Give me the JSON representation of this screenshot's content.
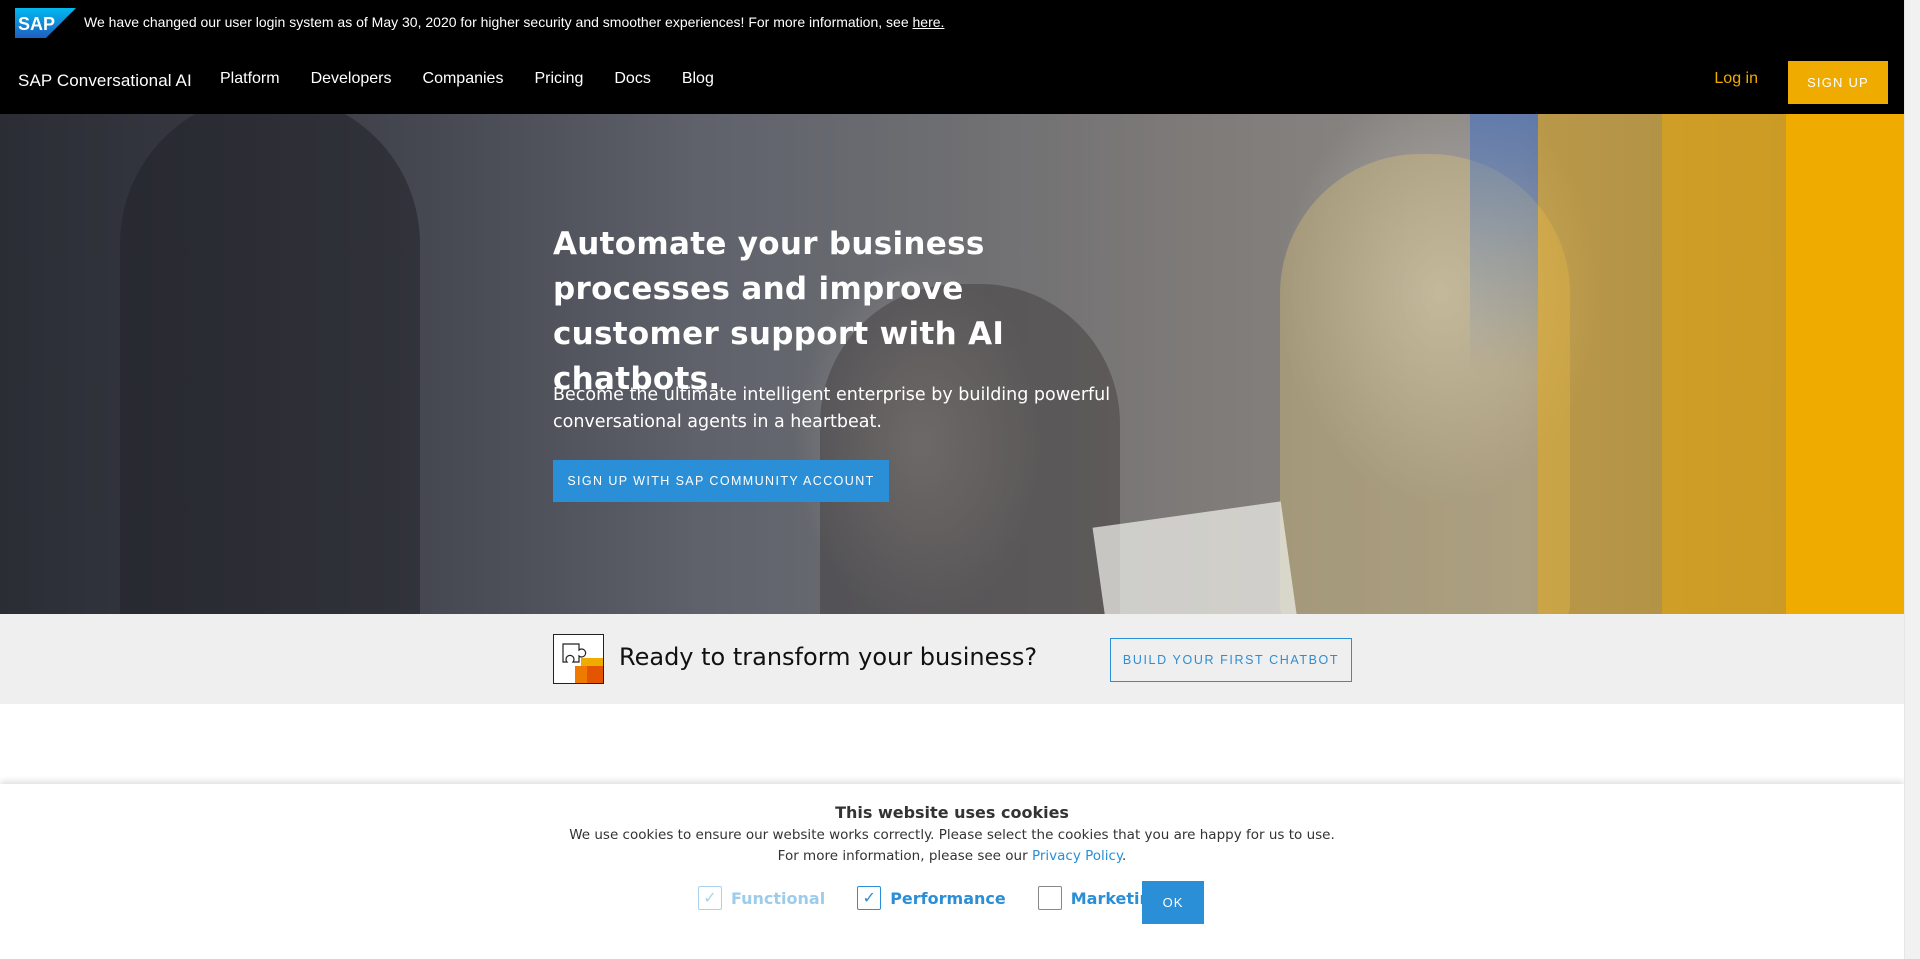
{
  "announcement": {
    "text": "We have changed our user login system as of May 30, 2020 for higher security and smoother experiences! For more information, see ",
    "link": "here."
  },
  "nav": {
    "logo_text": "SAP",
    "brand": "SAP Conversational AI",
    "links": [
      "Platform",
      "Developers",
      "Companies",
      "Pricing",
      "Docs",
      "Blog"
    ],
    "login": "Log in",
    "signup": "SIGN UP"
  },
  "hero": {
    "title": "Automate your business processes and improve customer support with AI chatbots.",
    "subtitle": "Become the ultimate intelligent enterprise by building powerful conversational agents in a heartbeat.",
    "cta": "SIGN UP WITH SAP COMMUNITY ACCOUNT"
  },
  "ready": {
    "text": "Ready to transform your business?",
    "button": "BUILD YOUR FIRST CHATBOT"
  },
  "cookie": {
    "title": "This website uses cookies",
    "line1": "We use cookies to ensure our website works correctly. Please select the cookies that you are happy for us to use.",
    "line2_prefix": "For more information, please see our ",
    "privacy_link": "Privacy Policy",
    "line2_suffix": ".",
    "options": [
      {
        "label": "Functional",
        "checked": true,
        "disabled": true
      },
      {
        "label": "Performance",
        "checked": true,
        "disabled": false
      },
      {
        "label": "Marketing",
        "checked": false,
        "disabled": false
      }
    ],
    "ok": "OK"
  },
  "colors": {
    "accent_yellow": "#f0ab00",
    "accent_blue": "#2a8fd6",
    "topbar": "#000000"
  }
}
